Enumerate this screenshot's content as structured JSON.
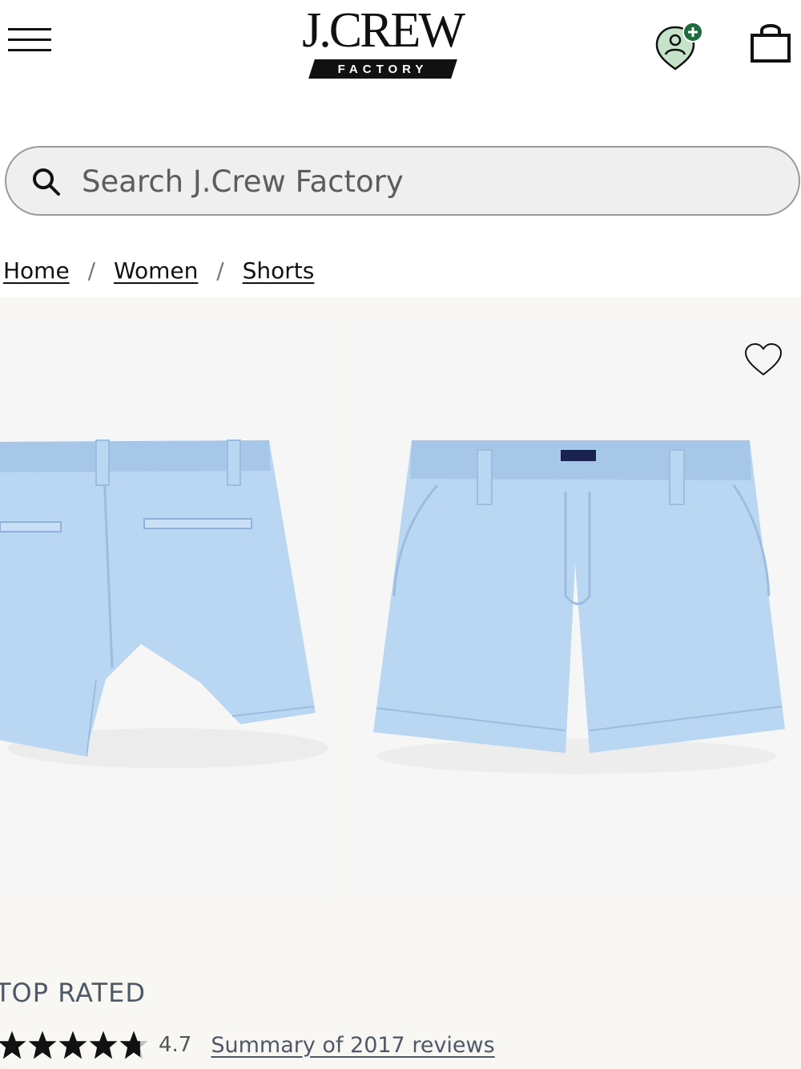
{
  "header": {
    "logo_word": "J.CREW",
    "logo_sub": "FACTORY",
    "icons": {
      "menu": "hamburger-menu-icon",
      "account": "account-pin-icon",
      "account_badge": "plus-badge-icon",
      "bag": "shopping-bag-icon"
    },
    "colors": {
      "account_badge": "#1e6b3c"
    }
  },
  "search": {
    "placeholder": "Search J.Crew Factory",
    "value": "",
    "icon": "search-icon"
  },
  "breadcrumb": {
    "items": [
      "Home",
      "Women",
      "Shorts"
    ],
    "separator": "/"
  },
  "gallery": {
    "images": [
      {
        "alt": "light blue chino shorts, back view"
      },
      {
        "alt": "light blue chino shorts, front view"
      }
    ],
    "wishlist_icon": "heart-outline-icon",
    "colors": {
      "shorts": "#b9d6f2",
      "shorts_shade": "#a7c7e8"
    }
  },
  "product": {
    "badge": "TOP RATED",
    "rating": 4.7,
    "rating_text": "4.7",
    "stars_max": 5,
    "reviews_link": "Summary of 2017 reviews"
  }
}
